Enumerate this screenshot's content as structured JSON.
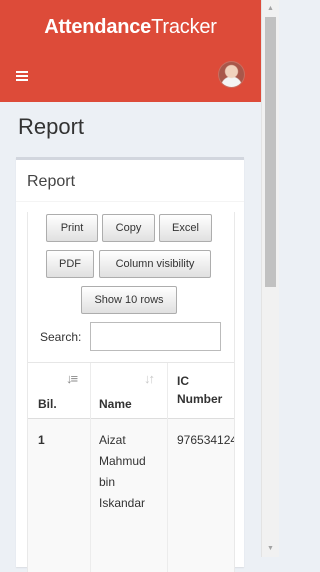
{
  "header": {
    "brand_bold": "Attendance",
    "brand_regular": "Tracker",
    "menu_icon": "hamburger-menu-icon",
    "avatar_icon": "user-avatar",
    "color": "#dd4b39"
  },
  "page": {
    "title": "Report"
  },
  "box": {
    "title": "Report"
  },
  "toolbar": {
    "print": "Print",
    "copy": "Copy",
    "excel": "Excel",
    "pdf": "PDF",
    "column_visibility": "Column visibility",
    "show_rows": "Show 10 rows"
  },
  "search": {
    "label": "Search:",
    "value": "",
    "placeholder": ""
  },
  "table": {
    "headers": [
      "Bil.",
      "Name",
      "IC\nNumber"
    ],
    "sort_icons": [
      "sort-numeric-down-icon",
      "sort-both-icon"
    ],
    "rows": [
      {
        "bil": "1",
        "name": "Aizat\nMahmud\nbin\nIskandar",
        "ic": "976534124"
      }
    ]
  }
}
